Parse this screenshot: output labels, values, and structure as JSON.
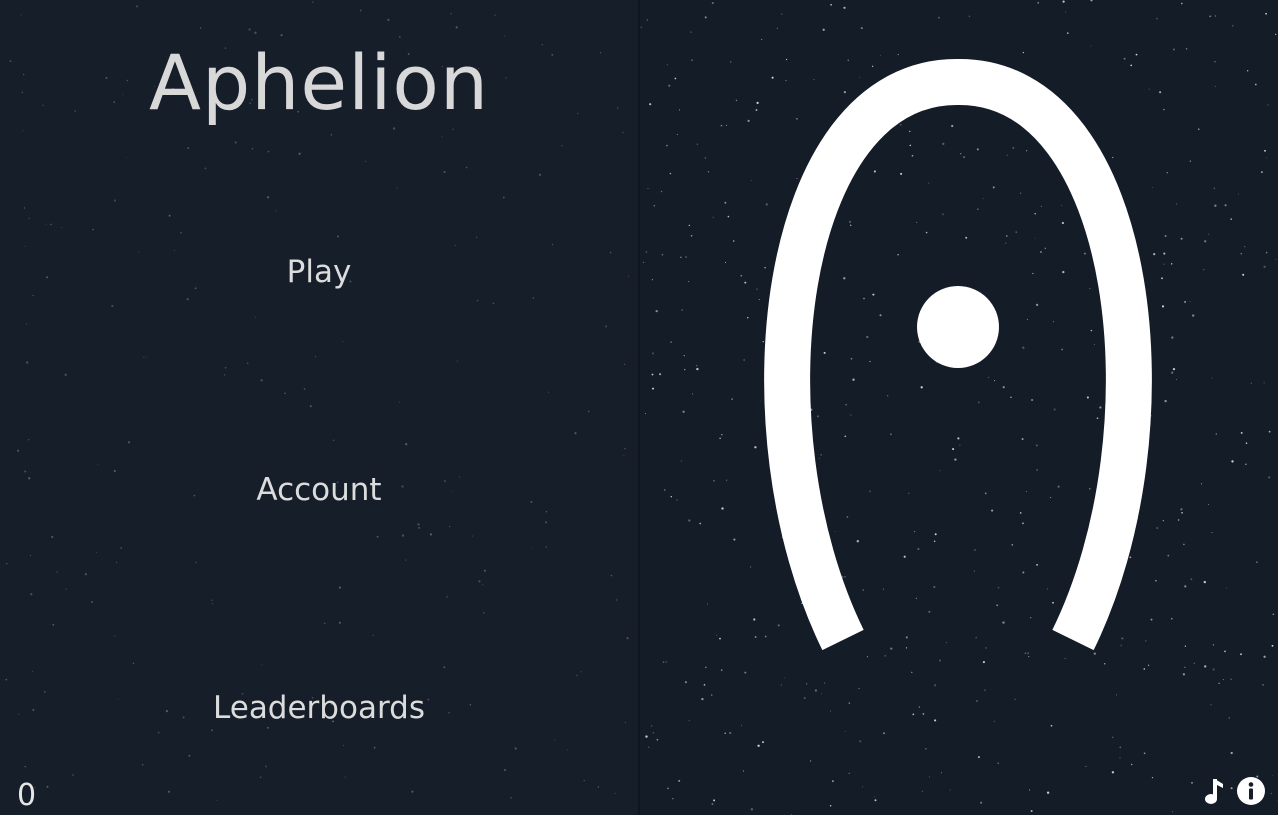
{
  "game": {
    "title": "Aphelion",
    "score": "0"
  },
  "menu": {
    "items": [
      {
        "label": "Play"
      },
      {
        "label": "Account"
      },
      {
        "label": "Leaderboards"
      }
    ]
  },
  "hud": {
    "icons": [
      "music-note-icon",
      "info-icon"
    ]
  },
  "colors": {
    "background": "#151d29",
    "panel": "#161e2a",
    "text": "#dcdcdc",
    "orbit": "#ffffff",
    "planet": "#ffffff"
  }
}
